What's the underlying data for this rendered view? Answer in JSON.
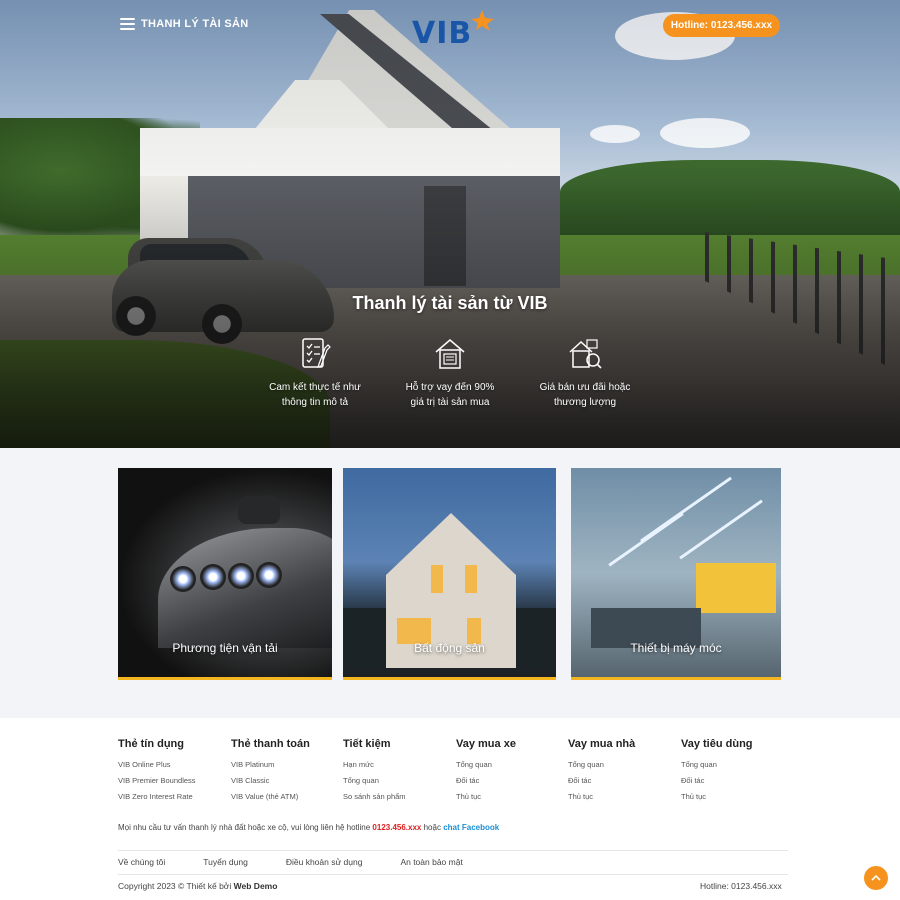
{
  "header": {
    "menu_label": "THANH LÝ TÀI SẢN",
    "logo_text": "VIB",
    "hotline_label": "Hotline: 0123.456.xxx"
  },
  "hero": {
    "title": "Thanh lý tài sản từ VIB",
    "features": [
      {
        "icon": "checklist-document-icon",
        "line1": "Cam kết thực tế như",
        "line2": "thông tin mô tả"
      },
      {
        "icon": "house-document-icon",
        "line1": "Hỗ trợ vay đến 90%",
        "line2": "giá trị tài sản mua"
      },
      {
        "icon": "house-price-icon",
        "line1": "Giá bán ưu đãi hoặc",
        "line2": "thương lượng"
      }
    ]
  },
  "categories": [
    {
      "label": "Phương tiện vận tải"
    },
    {
      "label": "Bất động sản"
    },
    {
      "label": "Thiết bị máy móc"
    }
  ],
  "footer": {
    "columns": [
      {
        "title": "Thẻ tín dụng",
        "links": [
          "VIB Online Plus",
          "VIB Premier Boundless",
          "VIB Zero Interest Rate"
        ]
      },
      {
        "title": "Thẻ thanh toán",
        "links": [
          "VIB Platinum",
          "VIB Classic",
          "VIB Value (thẻ ATM)"
        ]
      },
      {
        "title": "Tiết kiệm",
        "links": [
          "Hạn mức",
          "Tổng quan",
          "So sánh sản phẩm"
        ]
      },
      {
        "title": "Vay mua xe",
        "links": [
          "Tổng quan",
          "Đối tác",
          "Thủ tục"
        ]
      },
      {
        "title": "Vay mua nhà",
        "links": [
          "Tổng quan",
          "Đối tác",
          "Thủ tục"
        ]
      },
      {
        "title": "Vay tiêu dùng",
        "links": [
          "Tổng quan",
          "Đối tác",
          "Thủ tục"
        ]
      }
    ],
    "contact_text": "Mọi nhu cầu tư vấn thanh lý nhà đất hoặc xe cộ, vui lòng liên hệ hotline",
    "contact_hotline": "0123.456.xxx",
    "contact_or": "hoặc",
    "contact_chat": "chat Facebook",
    "bottom_links": [
      "Về chúng tôi",
      "Tuyển dụng",
      "Điều khoản sử dụng",
      "An toàn bảo mật"
    ],
    "copyright_prefix": "Copyright 2023 © Thiết kế bởi",
    "copyright_brand": "Web Demo",
    "hotline": "Hotline: 0123.456.xxx"
  },
  "colors": {
    "accent_orange": "#f6921e",
    "card_border_yellow": "#f4b51f",
    "logo_blue": "#1a56a8",
    "hotline_red": "#e02020",
    "facebook_blue": "#1a8fd6"
  },
  "icons": {
    "back_to_top": "chevron-up-icon"
  }
}
